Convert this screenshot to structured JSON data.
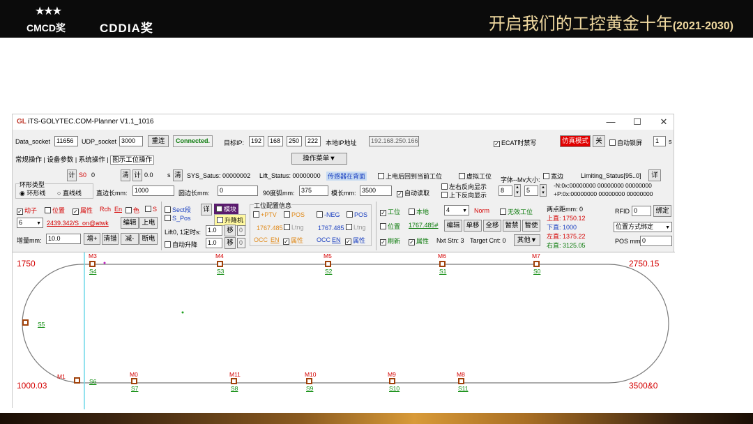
{
  "banner": {
    "logo1_stars": "★★★",
    "logo1_text": "CMCD奖",
    "logo2_text": "CDDIA奖",
    "slogan": "开启我们的工控黄金十年",
    "slogan_years": "(2021-2030)"
  },
  "window": {
    "title": "iTS-GOLYTEC.COM-Planner V1.1_1016",
    "logo": "GL",
    "controls": {
      "minimize": "—",
      "maximize": "☐",
      "close": "✕"
    }
  },
  "row1": {
    "data_socket_label": "Data_socket",
    "data_socket": "11656",
    "udp_socket_label": "UDP_socket",
    "udp_socket": "3000",
    "reconnect": "重连",
    "status": "Connected.",
    "target_ip_label": "目标IP:",
    "ip": [
      "192",
      "168",
      "250",
      "222"
    ],
    "local_ip_label": "本地IP地址",
    "local_ip": "192.168.250.166",
    "ecat_label": "ECAT时禁写",
    "sim_btn": "仿真模式",
    "close_btn": "关",
    "autolock_label": "自动锁屏",
    "autolock_value": "1",
    "autolock_unit": "s"
  },
  "tabs": [
    "常规操作",
    "设备参数",
    "系统操作",
    "图示工位操作"
  ],
  "op_menu": "操作菜单▼",
  "row3": {
    "count_label": "计",
    "s0": "S0",
    "s0_val": "0",
    "clear1": "清",
    "count2": "计",
    "count2_val": "0.0",
    "s_unit": "s",
    "clear2": "清",
    "sys_status": "SYS_Satus: 00000002",
    "lift_status": "Lift_Status: 00000000",
    "sensor_back": "传感器在背面",
    "power_back": "上电后回到当前工位",
    "virtual": "虚拟工位",
    "font_label": "字体--Mv大小:",
    "wide_label": "宽边",
    "limiting": "Limiting_Status[95..0]",
    "detail": "详",
    "limit_n": "-N:0x:00000000   00000000   00000000",
    "limit_p": "+P:0x:00000000   00000000   00000000"
  },
  "row4": {
    "ring_type": "环形类型",
    "ring": "环形线",
    "linear": "直线线",
    "straight_len_label": "直边长mm:",
    "straight_len": "1000",
    "arc_len_label": "圆边长mm:",
    "arc_len": "0",
    "deg90_label": "90度弧mm:",
    "deg90": "375",
    "mover_len_label": "模长mm:",
    "mover_len": "3500",
    "auto_read": "自动读取",
    "lr_reverse": "左右反向显示",
    "ud_reverse": "上下反向显示",
    "font_size": "8",
    "mv_size": "5"
  },
  "group_mover": {
    "mover": "动子",
    "position": "位置",
    "attr": "属性",
    "rch": "Rch",
    "en": "En",
    "color": "色",
    "s": "S",
    "sel": "6",
    "pos_text": "2439.342/S_on@atwk",
    "edit": "编辑",
    "power_on": "上电",
    "incr_label": "增量mm:",
    "incr": "10.0",
    "plus": "增+",
    "clear_err": "清错",
    "minus": "减-",
    "power_off": "断电"
  },
  "group_sect": {
    "sect": "Sect段",
    "detail": "详",
    "module": "模块",
    "spos": "S_Pos",
    "lift": "升降机",
    "lift0_label": "Lift0, 1定时s:",
    "lift0": "1.0",
    "move1": "移",
    "v1": "0",
    "auto_lift": "自动升降",
    "lift1": "1.0",
    "move2": "移",
    "v2": "0"
  },
  "group_station": {
    "title": "工位配置信息",
    "ptv": "+PTV",
    "pos1": "POS",
    "neg": "-NEG",
    "pos2": "POS",
    "val1": "1767.485",
    "ltng1": "Ltng",
    "val2": "1767.485",
    "ltng2": "Ltng",
    "occ1": "OCC",
    "en1": "EN",
    "attr1": "属性",
    "occ2": "OCC",
    "en2": "EN",
    "attr2": "属性"
  },
  "group_work": {
    "station": "工位",
    "local": "本地",
    "sel": "4",
    "norm": "Norm",
    "invalid": "无效工位",
    "position": "位置",
    "pos_val": "1767.485#",
    "edit": "编辑",
    "single": "单移",
    "all": "全移",
    "pause": "暂禁",
    "pause2": "暂使",
    "refresh": "刷新",
    "attr": "属性",
    "next": "Nxt Stn: 3",
    "target": "Target Cnt: 0",
    "other": "其他▼"
  },
  "group_dist": {
    "title": "两点距mm: 0",
    "top_label": "上直:",
    "top": "1750.12",
    "bottom_label": "下直:",
    "bottom": "1000",
    "left_label": "左直:",
    "left": "1375.22",
    "right_label": "右直:",
    "right": "3125.05"
  },
  "group_rfid": {
    "rfid_label": "RFID",
    "rfid": "0",
    "bind": "绑定",
    "mode": "位置方式绑定",
    "pos_label": "POS mm",
    "pos": "0"
  },
  "canvas": {
    "corner_tl": "1750",
    "corner_tr": "2750.15",
    "corner_bl": "1000.03",
    "corner_br": "3500&0",
    "top_nodes": [
      {
        "m": "M3",
        "s": "S4"
      },
      {
        "m": "M4",
        "s": "S3"
      },
      {
        "m": "M5",
        "s": "S2"
      },
      {
        "m": "M6",
        "s": "S1"
      },
      {
        "m": "M7",
        "s": "S0"
      }
    ],
    "left_node": {
      "s": "S5"
    },
    "bottom_nodes": [
      {
        "m": "M1",
        "s": "S6"
      },
      {
        "m": "M0",
        "s": "S7"
      },
      {
        "m": "M11",
        "s": "S8"
      },
      {
        "m": "M10",
        "s": "S9"
      },
      {
        "m": "M9",
        "s": "S10"
      },
      {
        "m": "M8",
        "s": "S11"
      }
    ],
    "colors": {
      "track": "#7a7a7a",
      "node": "#a0410a",
      "cursor": "#6fd8e8",
      "label_m": "#d40000",
      "label_s": "#0a8a0a"
    }
  }
}
